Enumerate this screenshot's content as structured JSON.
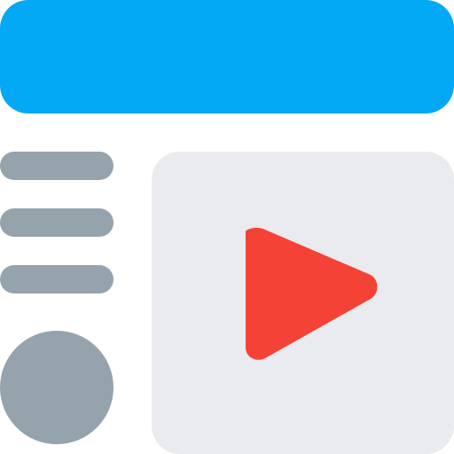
{
  "colors": {
    "header": "#03A9F4",
    "menu": "#94A3AC",
    "avatar": "#94A3AC",
    "panel": "#E9EBEE",
    "play": "#F44336"
  },
  "icons": {
    "menu": "menu-lines-icon",
    "avatar": "avatar-circle-icon",
    "play": "play-icon"
  }
}
